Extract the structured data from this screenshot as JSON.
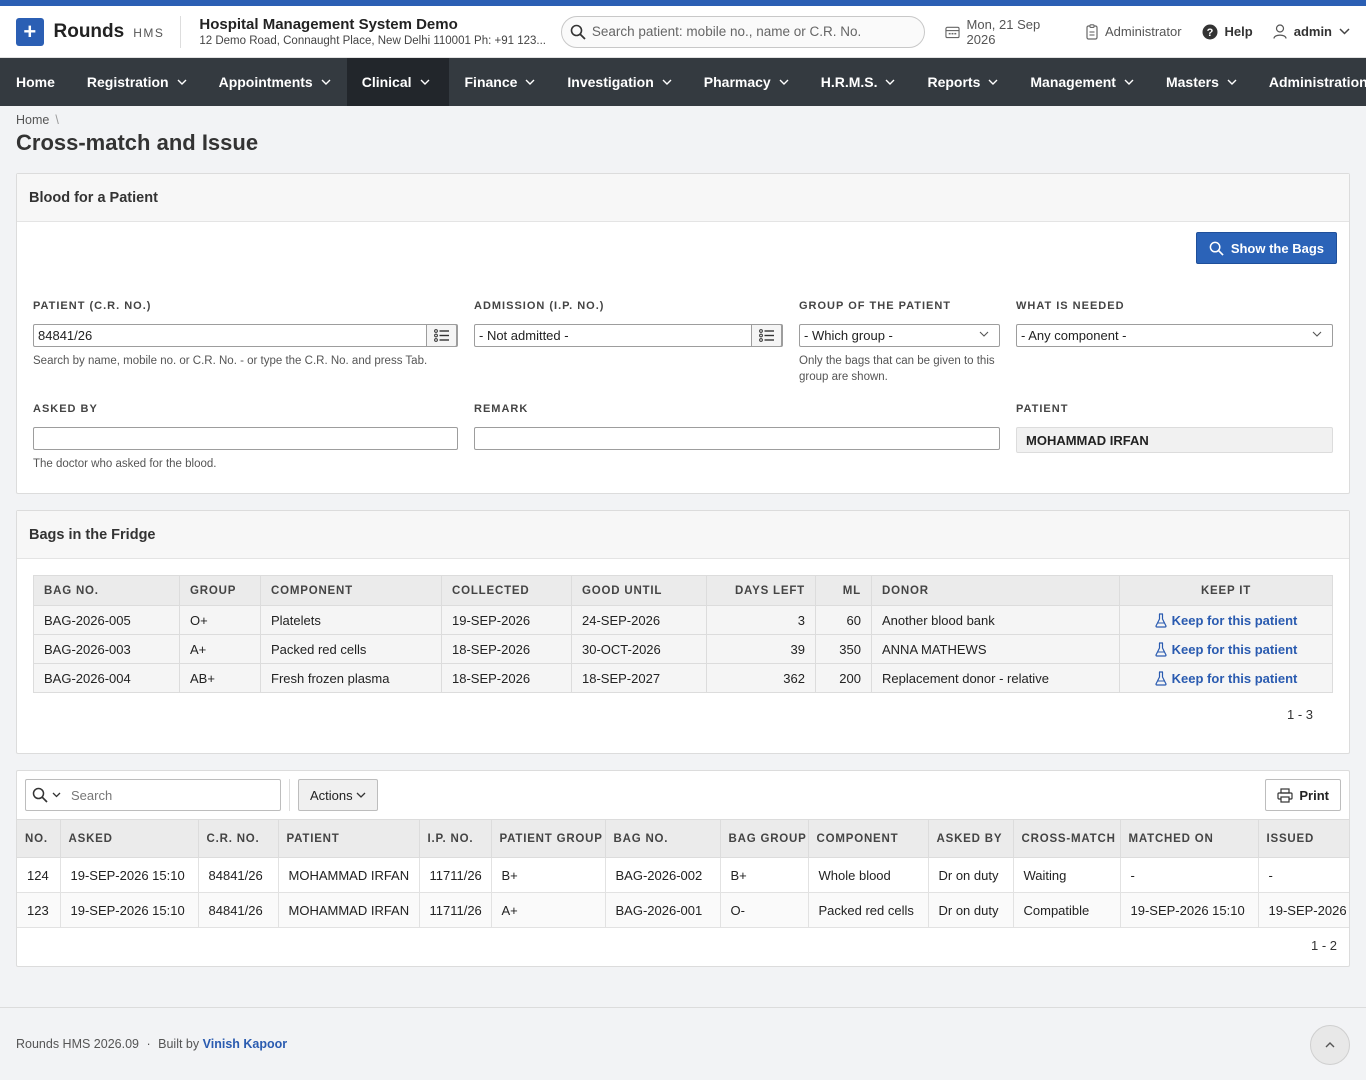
{
  "app": {
    "brand": "Rounds",
    "brand_sub": "HMS"
  },
  "hospital": {
    "name": "Hospital Management System Demo",
    "address": "12 Demo Road, Connaught Place, New Delhi 110001 Ph: +91 123..."
  },
  "header": {
    "search_placeholder": "Search patient: mobile no., name or C.R. No.",
    "date": "Mon, 21 Sep 2026",
    "role": "Administrator",
    "help": "Help",
    "user": "admin"
  },
  "nav": [
    "Home",
    "Registration",
    "Appointments",
    "Clinical",
    "Finance",
    "Investigation",
    "Pharmacy",
    "H.R.M.S.",
    "Reports",
    "Management",
    "Masters",
    "Administration"
  ],
  "nav_active": "Clinical",
  "breadcrumb": {
    "home": "Home",
    "sep": "\\"
  },
  "page_title": "Cross-match and Issue",
  "form": {
    "title": "Blood for a Patient",
    "show_button": "Show the Bags",
    "patient_label": "PATIENT (C.R. NO.)",
    "patient_value": "84841/26",
    "patient_help": "Search by name, mobile no. or C.R. No. - or type the C.R. No. and press Tab.",
    "admission_label": "ADMISSION (I.P. NO.)",
    "admission_value": "- Not admitted -",
    "group_label": "GROUP OF THE PATIENT",
    "group_value": "- Which group -",
    "group_help": "Only the bags that can be given to this group are shown.",
    "needed_label": "WHAT IS NEEDED",
    "needed_value": "- Any component -",
    "asked_label": "ASKED BY",
    "asked_value": "",
    "asked_help": "The doctor who asked for the blood.",
    "remark_label": "REMARK",
    "remark_value": "",
    "patient_name_label": "PATIENT",
    "patient_name_value": "MOHAMMAD IRFAN"
  },
  "bags": {
    "title": "Bags in the Fridge",
    "columns": [
      "BAG NO.",
      "GROUP",
      "COMPONENT",
      "COLLECTED",
      "GOOD UNTIL",
      "DAYS LEFT",
      "ML",
      "DONOR",
      "KEEP IT"
    ],
    "rows": [
      [
        "BAG-2026-005",
        "O+",
        "Platelets",
        "19-SEP-2026",
        "24-SEP-2026",
        "3",
        "60",
        "Another blood bank",
        "Keep for this patient"
      ],
      [
        "BAG-2026-003",
        "A+",
        "Packed red cells",
        "18-SEP-2026",
        "30-OCT-2026",
        "39",
        "350",
        "ANNA MATHEWS",
        "Keep for this patient"
      ],
      [
        "BAG-2026-004",
        "AB+",
        "Fresh frozen plasma",
        "18-SEP-2026",
        "18-SEP-2027",
        "362",
        "200",
        "Replacement donor - relative",
        "Keep for this patient"
      ]
    ],
    "pagination": "1 - 3"
  },
  "issues": {
    "search_placeholder": "Search",
    "actions": "Actions",
    "print": "Print",
    "columns": [
      "NO.",
      "ASKED",
      "C.R. NO.",
      "PATIENT",
      "I.P. NO.",
      "PATIENT GROUP",
      "BAG NO.",
      "BAG GROUP",
      "COMPONENT",
      "ASKED BY",
      "CROSS-MATCH",
      "MATCHED ON",
      "ISSUED"
    ],
    "rows": [
      [
        "124",
        "19-SEP-2026 15:10",
        "84841/26",
        "MOHAMMAD IRFAN",
        "11711/26",
        "B+",
        "BAG-2026-002",
        "B+",
        "Whole blood",
        "Dr on duty",
        "Waiting",
        "-",
        "-"
      ],
      [
        "123",
        "19-SEP-2026 15:10",
        "84841/26",
        "MOHAMMAD IRFAN",
        "11711/26",
        "A+",
        "BAG-2026-001",
        "O-",
        "Packed red cells",
        "Dr on duty",
        "Compatible",
        "19-SEP-2026 15:10",
        "19-SEP-2026"
      ]
    ],
    "pagination": "1 - 2"
  },
  "footer": {
    "version": "Rounds HMS 2026.09",
    "dot": "·",
    "built_by": "Built by",
    "author": "Vinish Kapoor"
  },
  "colors": {
    "accent": "#2b5fb4",
    "nav_bg": "#343a40",
    "link": "#2a5bb0"
  }
}
